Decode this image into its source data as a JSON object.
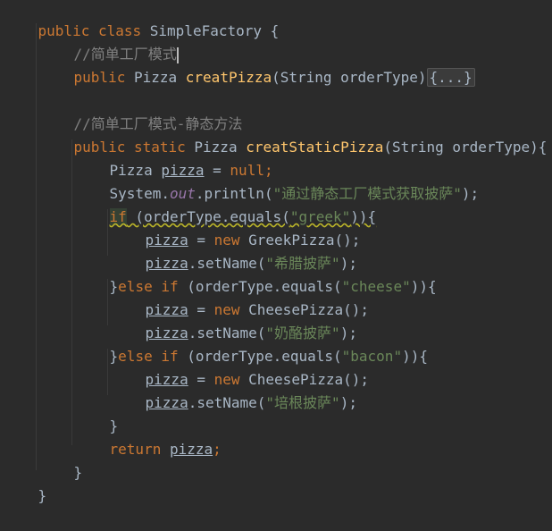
{
  "lines": {
    "l1": {
      "kw1": "public",
      "kw2": "class",
      "name": "SimpleFactory",
      "brace": " {"
    },
    "l2": {
      "comment": "//简单工厂模式"
    },
    "l3": {
      "kw": "public",
      "type": "Pizza",
      "fn": "creatPizza",
      "params": "(String orderType)",
      "fold": "{...}"
    },
    "l5": {
      "comment": "//简单工厂模式-静态方法"
    },
    "l6": {
      "kw1": "public",
      "kw2": "static",
      "type": "Pizza",
      "fn": "creatStaticPizza",
      "params": "(String orderType){"
    },
    "l7": {
      "type": "Pizza",
      "var": "pizza",
      "eq": " = ",
      "val": "null",
      "semi": ";"
    },
    "l8": {
      "pre": "System.",
      "field": "out",
      "mid": ".println(",
      "str": "\"通过静态工厂模式获取披萨\"",
      "end": ");"
    },
    "l9": {
      "kw": "if",
      "mid": " (orderType.equals(",
      "str": "\"greek\"",
      "end": ")){"
    },
    "l10": {
      "var": "pizza",
      "eq": " = ",
      "kw": "new",
      "rest": " GreekPizza();"
    },
    "l11": {
      "var": "pizza",
      "mid": ".setName(",
      "str": "\"希腊披萨\"",
      "end": ");"
    },
    "l12": {
      "pre": "}",
      "kw": "else if",
      "mid": " (orderType.equals(",
      "str": "\"cheese\"",
      "end": ")){"
    },
    "l13": {
      "var": "pizza",
      "eq": " = ",
      "kw": "new",
      "rest": " CheesePizza();"
    },
    "l14": {
      "var": "pizza",
      "mid": ".setName(",
      "str": "\"奶酪披萨\"",
      "end": ");"
    },
    "l15": {
      "pre": "}",
      "kw": "else if",
      "mid": " (orderType.equals(",
      "str": "\"bacon\"",
      "end": ")){"
    },
    "l16": {
      "var": "pizza",
      "eq": " = ",
      "kw": "new",
      "rest": " CheesePizza();"
    },
    "l17": {
      "var": "pizza",
      "mid": ".setName(",
      "str": "\"培根披萨\"",
      "end": ");"
    },
    "l18": {
      "brace": "}"
    },
    "l19": {
      "kw": "return",
      "var": "pizza",
      "semi": ";"
    },
    "l20": {
      "brace": "}"
    },
    "l21": {
      "brace": "}"
    }
  },
  "colors": {
    "background": "#2b2b2b",
    "keyword": "#cc7832",
    "function": "#ffc66d",
    "comment": "#808080",
    "string": "#6a8759",
    "field": "#9876aa",
    "text": "#a9b7c6"
  }
}
